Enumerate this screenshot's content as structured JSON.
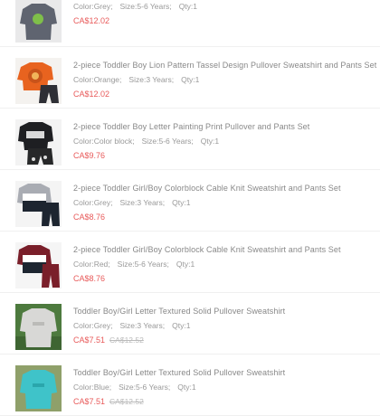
{
  "items": [
    {
      "title": "",
      "color_label": "Color:",
      "color": "Grey",
      "size_label": "Size:",
      "size": "5-6 Years",
      "qty_label": "Qty:",
      "qty": "1",
      "price": "CA$12.02",
      "old_price": "",
      "image": "sweatshirt-grey-green-graphic"
    },
    {
      "title": "2-piece Toddler Boy Lion Pattern Tassel Design Pullover Sweatshirt and Pants Set",
      "color_label": "Color:",
      "color": "Orange",
      "size_label": "Size:",
      "size": "3 Years",
      "qty_label": "Qty:",
      "qty": "1",
      "price": "CA$12.02",
      "old_price": "",
      "image": "orange-lion-sweatshirt-set"
    },
    {
      "title": "2-piece Toddler Boy Letter Painting Print Pullover and Pants Set",
      "color_label": "Color:",
      "color": "Color block",
      "size_label": "Size:",
      "size": "5-6 Years",
      "qty_label": "Qty:",
      "qty": "1",
      "price": "CA$9.76",
      "old_price": "",
      "image": "black-letter-print-set"
    },
    {
      "title": "2-piece Toddler Girl/Boy Colorblock Cable Knit Sweatshirt and Pants Set",
      "color_label": "Color:",
      "color": "Grey",
      "size_label": "Size:",
      "size": "3 Years",
      "qty_label": "Qty:",
      "qty": "1",
      "price": "CA$8.76",
      "old_price": "",
      "image": "grey-colorblock-knit-set"
    },
    {
      "title": "2-piece Toddler Girl/Boy Colorblock Cable Knit Sweatshirt and Pants Set",
      "color_label": "Color:",
      "color": "Red",
      "size_label": "Size:",
      "size": "5-6 Years",
      "qty_label": "Qty:",
      "qty": "1",
      "price": "CA$8.76",
      "old_price": "",
      "image": "red-colorblock-knit-set"
    },
    {
      "title": "Toddler Boy/Girl Letter Textured Solid Pullover Sweatshirt",
      "color_label": "Color:",
      "color": "Grey",
      "size_label": "Size:",
      "size": "3 Years",
      "qty_label": "Qty:",
      "qty": "1",
      "price": "CA$7.51",
      "old_price": "CA$12.52",
      "image": "grey-textured-sweatshirt"
    },
    {
      "title": "Toddler Boy/Girl Letter Textured Solid Pullover Sweatshirt",
      "color_label": "Color:",
      "color": "Blue",
      "size_label": "Size:",
      "size": "5-6 Years",
      "qty_label": "Qty:",
      "qty": "1",
      "price": "CA$7.51",
      "old_price": "CA$12.52",
      "image": "blue-textured-sweatshirt"
    }
  ],
  "colors": {
    "price": "#e85a5a",
    "text": "#888888",
    "old_price": "#bbbbbb"
  }
}
